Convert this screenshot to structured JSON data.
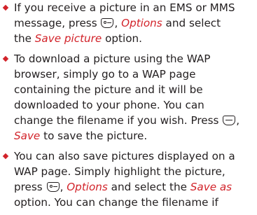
{
  "bullets": [
    {
      "line1": "If you receive a picture in an EMS or MMS",
      "line2_a": "message, press ",
      "key_icon": "left-softkey-icon",
      "line2_sep": ", ",
      "line2_em": "Options",
      "line2_b": " and select",
      "line3_a": "the ",
      "line3_em": "Save picture",
      "line3_b": " option."
    },
    {
      "line1": "To download a picture using the WAP",
      "line2": "browser, simply go to a WAP page",
      "line3": "containing the picture and it will be",
      "line4": "downloaded to your phone. You can",
      "line5_a": "change the filename if you wish. Press ",
      "key_icon": "right-softkey-icon",
      "line5_b": ",",
      "line6_em": "Save",
      "line6_b": " to save the picture."
    },
    {
      "line1": "You can also save pictures displayed on a",
      "line2": "WAP page. Simply highlight the picture,",
      "line3_a": "press ",
      "key_icon": "left-softkey-icon",
      "line3_sep": ", ",
      "line3_em": "Options",
      "line3_b": " and select the ",
      "line3_em2": "Save as",
      "line4": "option. You can change the filename if"
    }
  ],
  "colors": {
    "accent": "#d2232a",
    "text": "#231f20"
  }
}
